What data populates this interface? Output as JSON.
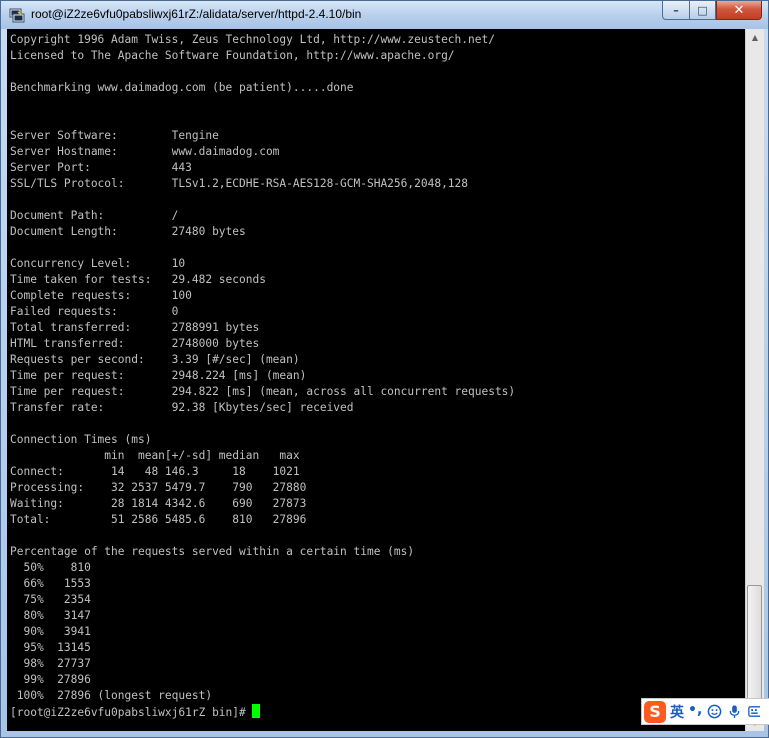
{
  "window": {
    "title": "root@iZ2ze6vfu0pabsliwxj61rZ:/alidata/server/httpd-2.4.10/bin",
    "controls": {
      "minimize": "–",
      "maximize": "□",
      "close": "✕"
    }
  },
  "terminal": {
    "lines": [
      "Copyright 1996 Adam Twiss, Zeus Technology Ltd, http://www.zeustech.net/",
      "Licensed to The Apache Software Foundation, http://www.apache.org/",
      "",
      "Benchmarking www.daimadog.com (be patient).....done",
      "",
      "",
      "Server Software:        Tengine",
      "Server Hostname:        www.daimadog.com",
      "Server Port:            443",
      "SSL/TLS Protocol:       TLSv1.2,ECDHE-RSA-AES128-GCM-SHA256,2048,128",
      "",
      "Document Path:          /",
      "Document Length:        27480 bytes",
      "",
      "Concurrency Level:      10",
      "Time taken for tests:   29.482 seconds",
      "Complete requests:      100",
      "Failed requests:        0",
      "Total transferred:      2788991 bytes",
      "HTML transferred:       2748000 bytes",
      "Requests per second:    3.39 [#/sec] (mean)",
      "Time per request:       2948.224 [ms] (mean)",
      "Time per request:       294.822 [ms] (mean, across all concurrent requests)",
      "Transfer rate:          92.38 [Kbytes/sec] received",
      "",
      "Connection Times (ms)",
      "              min  mean[+/-sd] median   max",
      "Connect:       14   48 146.3     18    1021",
      "Processing:    32 2537 5479.7    790   27880",
      "Waiting:       28 1814 4342.6    690   27873",
      "Total:         51 2586 5485.6    810   27896",
      "",
      "Percentage of the requests served within a certain time (ms)",
      "  50%    810",
      "  66%   1553",
      "  75%   2354",
      "  80%   3147",
      "  90%   3941",
      "  95%  13145",
      "  98%  27737",
      "  99%  27896",
      " 100%  27896 (longest request)"
    ],
    "prompt": "[root@iZ2ze6vfu0pabsliwxj61rZ bin]#",
    "cursor_color": "#00ff00",
    "text_color": "#c0c0c0",
    "background": "#000000"
  },
  "scrollbar": {
    "up_arrow": "▲",
    "down_arrow": "▼"
  },
  "ime": {
    "logo": "S",
    "mode": "英",
    "punct": "•,",
    "icons": [
      "smiley-icon",
      "microphone-icon",
      "keyboard-icon"
    ]
  }
}
